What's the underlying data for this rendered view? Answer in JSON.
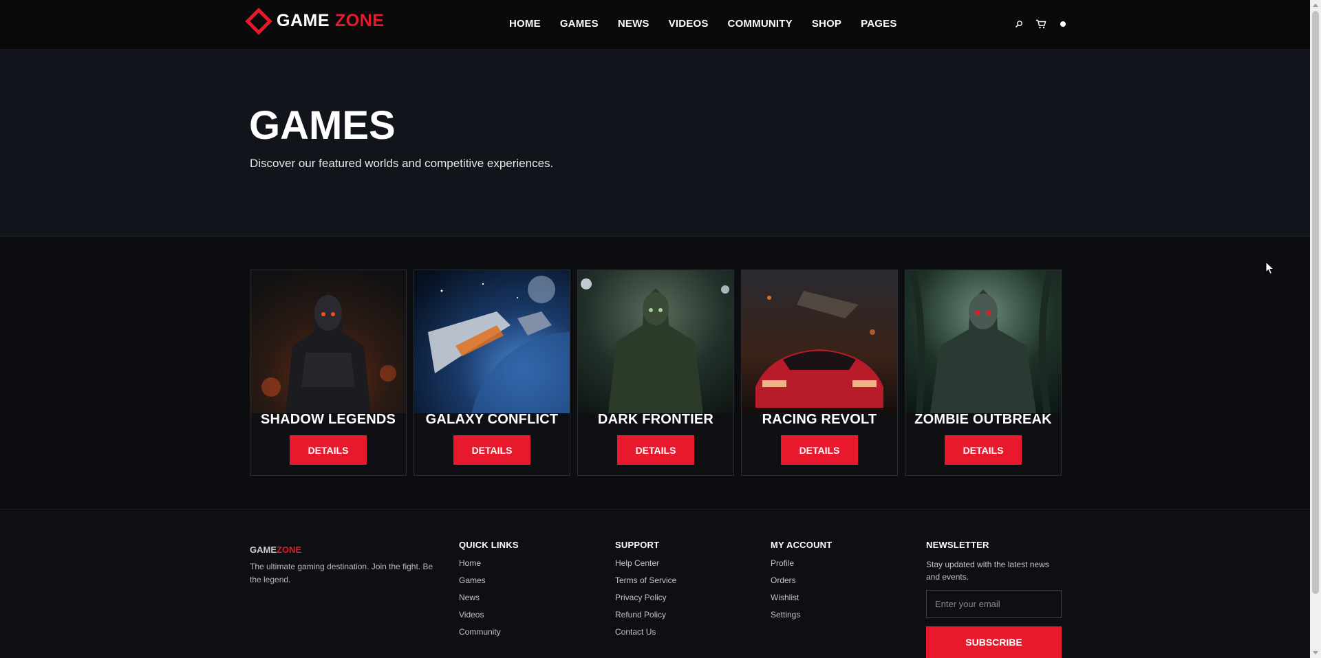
{
  "header": {
    "logo_left": "GAME",
    "logo_right": "ZONE",
    "nav": [
      "HOME",
      "GAMES",
      "NEWS",
      "VIDEOS",
      "COMMUNITY",
      "SHOP",
      "PAGES"
    ],
    "icons": [
      "search-icon",
      "cart-icon",
      "user-icon"
    ]
  },
  "hero": {
    "title": "GAMES",
    "subtitle": "Discover our featured worlds and competitive experiences."
  },
  "games": [
    {
      "title": "SHADOW LEGENDS",
      "button": "DETAILS",
      "accent": "#d9501c"
    },
    {
      "title": "GALAXY CONFLICT",
      "button": "DETAILS",
      "accent": "#3a7fd0"
    },
    {
      "title": "DARK FRONTIER",
      "button": "DETAILS",
      "accent": "#5a7a4a"
    },
    {
      "title": "RACING REVOLT",
      "button": "DETAILS",
      "accent": "#d02030"
    },
    {
      "title": "ZOMBIE OUTBREAK",
      "button": "DETAILS",
      "accent": "#4a8a6a"
    }
  ],
  "footer": {
    "brand_left": "GAME",
    "brand_right": "ZONE",
    "about": "The ultimate gaming destination. Join the fight. Be the legend.",
    "quick_links": {
      "title": "QUICK LINKS",
      "items": [
        "Home",
        "Games",
        "News",
        "Videos",
        "Community"
      ]
    },
    "support": {
      "title": "SUPPORT",
      "items": [
        "Help Center",
        "Terms of Service",
        "Privacy Policy",
        "Refund Policy",
        "Contact Us"
      ]
    },
    "account": {
      "title": "MY ACCOUNT",
      "items": [
        "Profile",
        "Orders",
        "Wishlist",
        "Settings"
      ]
    },
    "newsletter": {
      "title": "NEWSLETTER",
      "text": "Stay updated with the latest news and events.",
      "placeholder": "Enter your email",
      "button": "SUBSCRIBE"
    }
  },
  "colors": {
    "accent": "#e8192c",
    "background": "#0b0d11"
  }
}
